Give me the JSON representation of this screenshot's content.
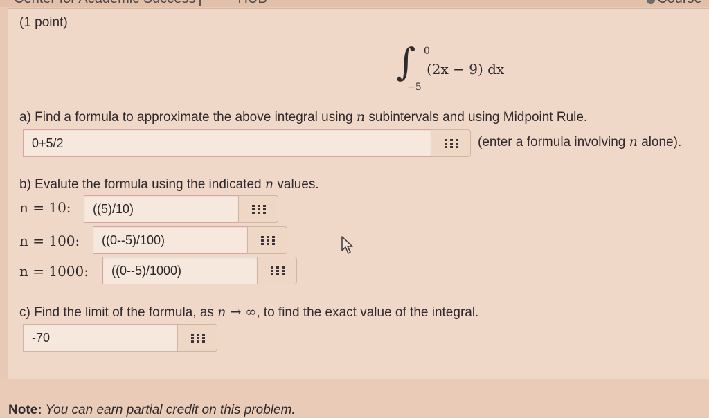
{
  "header": {
    "site_text": "Center for Academic Success",
    "nav_text": "HUB",
    "course_text": "Course"
  },
  "problem": {
    "points": "(1 point)",
    "integral": {
      "upper": "0",
      "lower": "−5",
      "integrand": "(2x − 9) dx"
    }
  },
  "part_a": {
    "question_pre": "a) Find a formula to approximate the above integral using ",
    "question_var": "n",
    "question_post": " subintervals and using Midpoint Rule.",
    "answer": "0+5/2",
    "hint_pre": "(enter a formula involving ",
    "hint_var": "n",
    "hint_post": " alone)."
  },
  "part_b": {
    "question_pre": "b) Evalute the formula using the indicated ",
    "question_var": "n",
    "question_post": " values.",
    "rows": [
      {
        "label": "n = 10:",
        "answer": "((5)/10)"
      },
      {
        "label": "n = 100:",
        "answer": "((0--5)/100)"
      },
      {
        "label": "n = 1000:",
        "answer": "((0--5)/1000)"
      }
    ]
  },
  "part_c": {
    "question_pre": "c) Find the limit of the formula, as ",
    "question_math": "n → ∞",
    "question_post": ", to find the exact value of the integral.",
    "answer": "-70"
  },
  "note": {
    "label": "Note:",
    "text": " You can earn partial credit on this problem."
  },
  "icons": [
    "grid-palette-icon",
    "cursor-arrow-icon",
    "gear-icon"
  ]
}
